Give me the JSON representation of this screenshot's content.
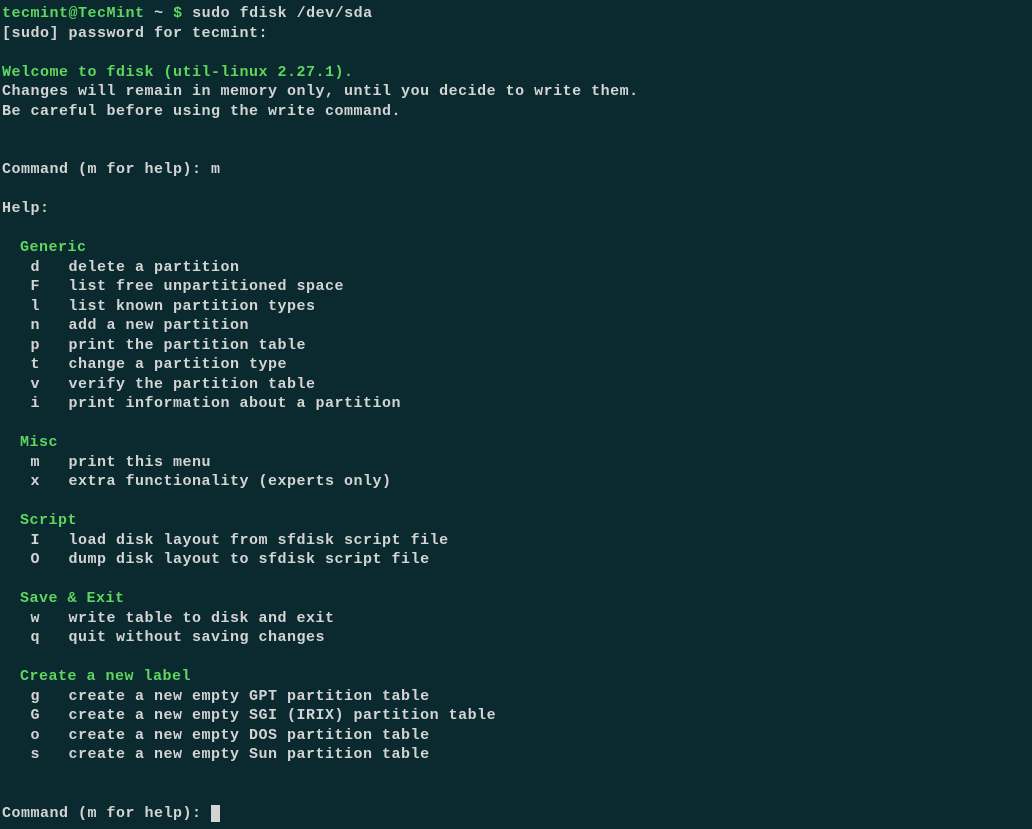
{
  "prompt": {
    "user": "tecmint",
    "at": "@",
    "host": "TecMint",
    "path": "~",
    "symbol": "$"
  },
  "command": "sudo fdisk /dev/sda",
  "sudo_line": "[sudo] password for tecmint:",
  "welcome": "Welcome to fdisk (util-linux 2.27.1).",
  "warn1": "Changes will remain in memory only, until you decide to write them.",
  "warn2": "Be careful before using the write command.",
  "cmd_prompt": "Command (m for help): ",
  "user_input_m": "m",
  "help_label": "Help:",
  "sections": {
    "generic": {
      "title": "Generic",
      "items": [
        {
          "key": "d",
          "desc": "delete a partition"
        },
        {
          "key": "F",
          "desc": "list free unpartitioned space"
        },
        {
          "key": "l",
          "desc": "list known partition types"
        },
        {
          "key": "n",
          "desc": "add a new partition"
        },
        {
          "key": "p",
          "desc": "print the partition table"
        },
        {
          "key": "t",
          "desc": "change a partition type"
        },
        {
          "key": "v",
          "desc": "verify the partition table"
        },
        {
          "key": "i",
          "desc": "print information about a partition"
        }
      ]
    },
    "misc": {
      "title": "Misc",
      "items": [
        {
          "key": "m",
          "desc": "print this menu"
        },
        {
          "key": "x",
          "desc": "extra functionality (experts only)"
        }
      ]
    },
    "script": {
      "title": "Script",
      "items": [
        {
          "key": "I",
          "desc": "load disk layout from sfdisk script file"
        },
        {
          "key": "O",
          "desc": "dump disk layout to sfdisk script file"
        }
      ]
    },
    "save": {
      "title": "Save & Exit",
      "items": [
        {
          "key": "w",
          "desc": "write table to disk and exit"
        },
        {
          "key": "q",
          "desc": "quit without saving changes"
        }
      ]
    },
    "label": {
      "title": "Create a new label",
      "items": [
        {
          "key": "g",
          "desc": "create a new empty GPT partition table"
        },
        {
          "key": "G",
          "desc": "create a new empty SGI (IRIX) partition table"
        },
        {
          "key": "o",
          "desc": "create a new empty DOS partition table"
        },
        {
          "key": "s",
          "desc": "create a new empty Sun partition table"
        }
      ]
    }
  }
}
